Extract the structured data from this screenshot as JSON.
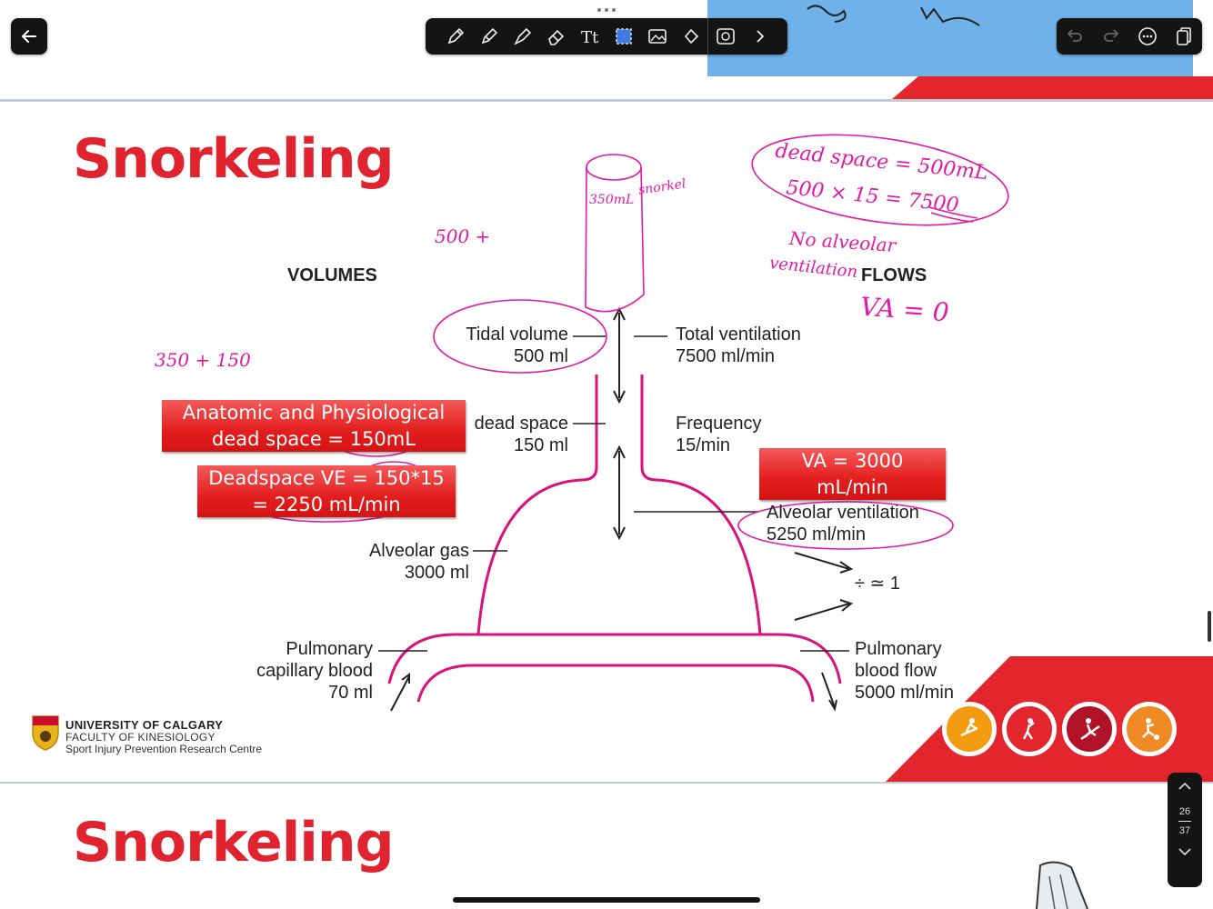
{
  "slide": {
    "title": "Snorkeling",
    "headers": {
      "volumes": "VOLUMES",
      "flows": "FLOWS"
    },
    "labels": {
      "tidal_volume": "Tidal volume",
      "tidal_volume_value": "500 ml",
      "dead_space": "dead space",
      "dead_space_value": "150 ml",
      "alveolar_gas": "Alveolar gas",
      "alveolar_gas_value": "3000 ml",
      "pulmonary_capillary_1": "Pulmonary",
      "pulmonary_capillary_2": "capillary blood",
      "pulmonary_capillary_value": "70 ml",
      "total_ventilation": "Total ventilation",
      "total_ventilation_value": "7500 ml/min",
      "frequency": "Frequency",
      "frequency_value": "15/min",
      "alveolar_ventilation": "Alveolar ventilation",
      "alveolar_ventilation_value": "5250 ml/min",
      "ratio": "÷ ≃ 1",
      "pulmonary_flow_1": "Pulmonary",
      "pulmonary_flow_2": "blood flow",
      "pulmonary_flow_value": "5000 ml/min"
    },
    "red_boxes": {
      "anatomic_line1": "Anatomic  and Physiological",
      "anatomic_line2": "dead space = 150mL",
      "deadspace_line1": "Deadspace VE = 150*15",
      "deadspace_line2": "= 2250 mL/min",
      "va_line1": "VA = 3000",
      "va_line2": "mL/min"
    },
    "handwriting": {
      "snorkel_volume": "350mL",
      "snorkel": "snorkel",
      "calc_500": "500 +",
      "calc_350": "350 + 150",
      "dead_space_note": "dead space = 500mL",
      "product": "500 × 15 = 7500",
      "no_alveolar": "No alveolar",
      "ventilation": "ventilation",
      "va_zero": "VA = 0"
    },
    "logo": {
      "university": "UNIVERSITY OF CALGARY",
      "faculty": "FACULTY OF KINESIOLOGY",
      "centre": "Sport Injury Prevention Research Centre"
    }
  },
  "next_slide": {
    "title": "Snorkeling"
  },
  "page_indicator": {
    "current": "26",
    "total": "37"
  },
  "colors": {
    "title_red": "#e0242f",
    "ink_magenta": "#e01aa6",
    "diagram_magenta": "#d8127f",
    "toolbar": "#141414"
  }
}
